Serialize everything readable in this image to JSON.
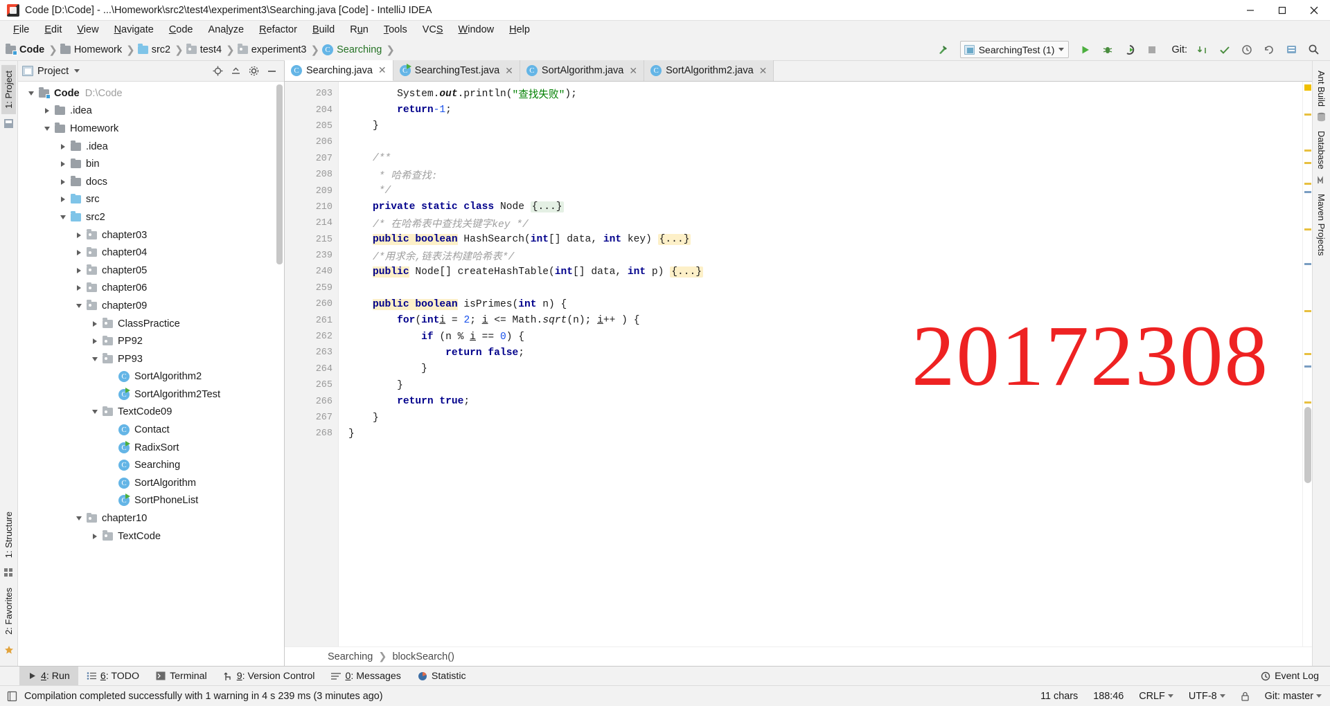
{
  "window": {
    "title": "Code [D:\\Code] - ...\\Homework\\src2\\test4\\experiment3\\Searching.java [Code] - IntelliJ IDEA",
    "minimize_label": "Minimize",
    "maximize_label": "Restore",
    "close_label": "Close"
  },
  "menubar": [
    {
      "label": "File"
    },
    {
      "label": "Edit"
    },
    {
      "label": "View"
    },
    {
      "label": "Navigate"
    },
    {
      "label": "Code"
    },
    {
      "label": "Analyze"
    },
    {
      "label": "Refactor"
    },
    {
      "label": "Build"
    },
    {
      "label": "Run"
    },
    {
      "label": "Tools"
    },
    {
      "label": "VCS"
    },
    {
      "label": "Window"
    },
    {
      "label": "Help"
    }
  ],
  "navbar": {
    "breadcrumbs": [
      {
        "label": "Code",
        "icon": "folder-module-icon"
      },
      {
        "label": "Homework",
        "icon": "folder-icon"
      },
      {
        "label": "src2",
        "icon": "folder-source-icon"
      },
      {
        "label": "test4",
        "icon": "folder-package-icon"
      },
      {
        "label": "experiment3",
        "icon": "folder-package-icon"
      },
      {
        "label": "Searching",
        "icon": "java-class-icon"
      }
    ],
    "build_icon": "hammer-icon",
    "run_config": "SearchingTest (1)",
    "run_icon": "run-icon",
    "debug_icon": "debug-icon",
    "run_coverage_icon": "run-with-coverage-icon",
    "stop_icon": "stop-icon",
    "git_label": "Git:",
    "git_update_icon": "git-update-icon",
    "git_commit_icon": "git-commit-icon",
    "git_history_icon": "git-history-icon",
    "git_revert_icon": "git-revert-icon",
    "search_icon": "search-icon",
    "settings_icon": "settings-icon"
  },
  "left_rail": [
    {
      "label": "1: Project"
    },
    {
      "label": "1: Structure"
    },
    {
      "label": "2: Favorites"
    }
  ],
  "right_rail": [
    {
      "label": "Ant Build"
    },
    {
      "label": "Database"
    },
    {
      "label": "Maven Projects"
    }
  ],
  "project_panel": {
    "title": "Project",
    "locate_icon": "locate-icon",
    "collapse_icon": "collapse-all-icon",
    "settings_icon": "gear-icon",
    "hide_icon": "hide-icon",
    "tree": [
      {
        "label": "Code",
        "path": "D:\\Code",
        "depth": 0,
        "state": "expanded",
        "icon": "module-folder-icon",
        "bold": true
      },
      {
        "label": ".idea",
        "depth": 1,
        "state": "collapsed",
        "icon": "folder-icon"
      },
      {
        "label": "Homework",
        "depth": 1,
        "state": "expanded",
        "icon": "folder-icon"
      },
      {
        "label": ".idea",
        "depth": 2,
        "state": "collapsed",
        "icon": "folder-icon"
      },
      {
        "label": "bin",
        "depth": 2,
        "state": "collapsed",
        "icon": "folder-icon"
      },
      {
        "label": "docs",
        "depth": 2,
        "state": "collapsed",
        "icon": "folder-icon"
      },
      {
        "label": "src",
        "depth": 2,
        "state": "collapsed",
        "icon": "source-folder-icon"
      },
      {
        "label": "src2",
        "depth": 2,
        "state": "expanded",
        "icon": "source-folder-icon"
      },
      {
        "label": "chapter03",
        "depth": 3,
        "state": "collapsed",
        "icon": "package-icon"
      },
      {
        "label": "chapter04",
        "depth": 3,
        "state": "collapsed",
        "icon": "package-icon"
      },
      {
        "label": "chapter05",
        "depth": 3,
        "state": "collapsed",
        "icon": "package-icon"
      },
      {
        "label": "chapter06",
        "depth": 3,
        "state": "collapsed",
        "icon": "package-icon"
      },
      {
        "label": "chapter09",
        "depth": 3,
        "state": "expanded",
        "icon": "package-icon"
      },
      {
        "label": "ClassPractice",
        "depth": 4,
        "state": "collapsed",
        "icon": "package-icon"
      },
      {
        "label": "PP92",
        "depth": 4,
        "state": "collapsed",
        "icon": "package-icon"
      },
      {
        "label": "PP93",
        "depth": 4,
        "state": "expanded",
        "icon": "package-icon"
      },
      {
        "label": "SortAlgorithm2",
        "depth": 5,
        "state": "leaf",
        "icon": "java-class-icon"
      },
      {
        "label": "SortAlgorithm2Test",
        "depth": 5,
        "state": "leaf",
        "icon": "java-test-class-icon"
      },
      {
        "label": "TextCode09",
        "depth": 4,
        "state": "expanded",
        "icon": "package-icon"
      },
      {
        "label": "Contact",
        "depth": 5,
        "state": "leaf",
        "icon": "java-class-icon"
      },
      {
        "label": "RadixSort",
        "depth": 5,
        "state": "leaf",
        "icon": "java-test-class-icon"
      },
      {
        "label": "Searching",
        "depth": 5,
        "state": "leaf",
        "icon": "java-class-icon"
      },
      {
        "label": "SortAlgorithm",
        "depth": 5,
        "state": "leaf",
        "icon": "java-class-icon"
      },
      {
        "label": "SortPhoneList",
        "depth": 5,
        "state": "leaf",
        "icon": "java-test-class-icon"
      },
      {
        "label": "chapter10",
        "depth": 3,
        "state": "expanded",
        "icon": "package-icon"
      },
      {
        "label": "TextCode",
        "depth": 4,
        "state": "collapsed",
        "icon": "package-icon"
      }
    ]
  },
  "editor": {
    "tabs": [
      {
        "label": "Searching.java",
        "active": true,
        "icon": "java-class-icon"
      },
      {
        "label": "SearchingTest.java",
        "active": false,
        "icon": "java-test-class-icon"
      },
      {
        "label": "SortAlgorithm.java",
        "active": false,
        "icon": "java-class-icon"
      },
      {
        "label": "SortAlgorithm2.java",
        "active": false,
        "icon": "java-class-icon"
      }
    ],
    "line_numbers": [
      "203",
      "204",
      "205",
      "206",
      "207",
      "208",
      "209",
      "210",
      "214",
      "215",
      "239",
      "240",
      "259",
      "260",
      "261",
      "262",
      "263",
      "264",
      "265",
      "266",
      "267",
      "268"
    ],
    "watermark": "20172308",
    "watermark_color": "#ee2222",
    "breadcrumb": [
      "Searching",
      "blockSearch()"
    ],
    "code_lines": [
      "System.out.println(\"查找失败\");",
      "return -1;",
      "}",
      "",
      "/**",
      " * 哈希查找:",
      " */",
      "private static class Node {...}",
      "/* 在哈希表中查找关键字key */",
      "public boolean HashSearch(int[] data, int key) {...}",
      "/*用求余,链表法构建哈希表*/",
      "public Node[] createHashTable(int[] data, int p) {...}",
      "",
      "public boolean isPrimes(int n) {",
      "for(int i = 2; i <= Math.sqrt(n); i++ ) {",
      "if (n % i == 0) {",
      "return false;",
      "}",
      "}",
      "return true;",
      "}",
      "}"
    ]
  },
  "bottom_toolbar": {
    "buttons": [
      {
        "label": "4: Run",
        "accel": "4",
        "icon": "run-icon",
        "selected": true
      },
      {
        "label": "6: TODO",
        "accel": "6",
        "icon": "todo-icon",
        "selected": false
      },
      {
        "label": "Terminal",
        "accel": "",
        "icon": "terminal-icon",
        "selected": false
      },
      {
        "label": "9: Version Control",
        "accel": "9",
        "icon": "branch-icon",
        "selected": false
      },
      {
        "label": "0: Messages",
        "accel": "0",
        "icon": "messages-icon",
        "selected": false
      },
      {
        "label": "Statistic",
        "accel": "",
        "icon": "statistic-icon",
        "selected": false
      }
    ],
    "event_log": "Event Log",
    "event_log_icon": "event-log-icon"
  },
  "statusbar": {
    "message_icon": "compile-icon",
    "message": "Compilation completed successfully with 1 warning in 4 s 239 ms (3 minutes ago)",
    "chars": "11 chars",
    "caret": "188:46",
    "line_separator": "CRLF",
    "encoding": "UTF-8",
    "branch": "Git: master",
    "lock_icon": "lock-icon"
  }
}
